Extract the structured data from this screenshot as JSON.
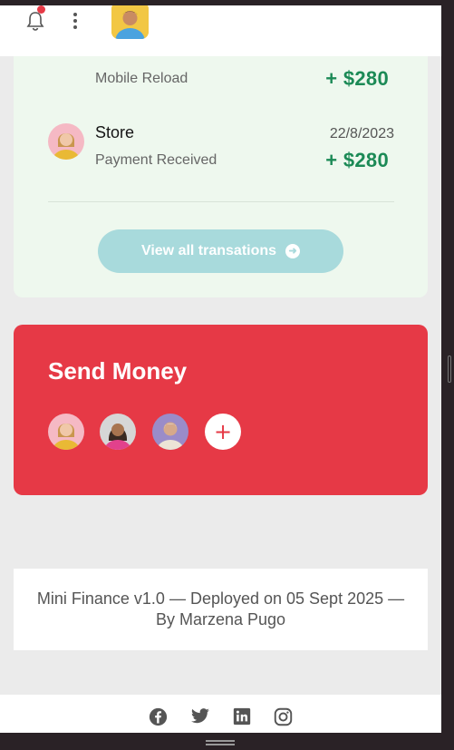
{
  "header": {
    "bell_icon": "bell-icon",
    "menu_icon": "kebab-menu-icon",
    "notification_dot_color": "#e63946"
  },
  "transactions": {
    "rows": [
      {
        "name": "",
        "subtitle": "Mobile Reload",
        "date": "",
        "amount": "+ $280"
      },
      {
        "name": "Store",
        "subtitle": "Payment Received",
        "date": "22/8/2023",
        "amount": "+ $280"
      }
    ],
    "view_all_label": "View all transations",
    "amount_color": "#1c8a56"
  },
  "send_money": {
    "title": "Send Money",
    "add_label": "+",
    "accent": "#e63946"
  },
  "footer": {
    "note": "Mini Finance v1.0 — Deployed on 05 Sept 2025 — By Marzena Pugo"
  },
  "social": [
    "facebook-icon",
    "twitter-icon",
    "linkedin-icon",
    "instagram-icon"
  ]
}
